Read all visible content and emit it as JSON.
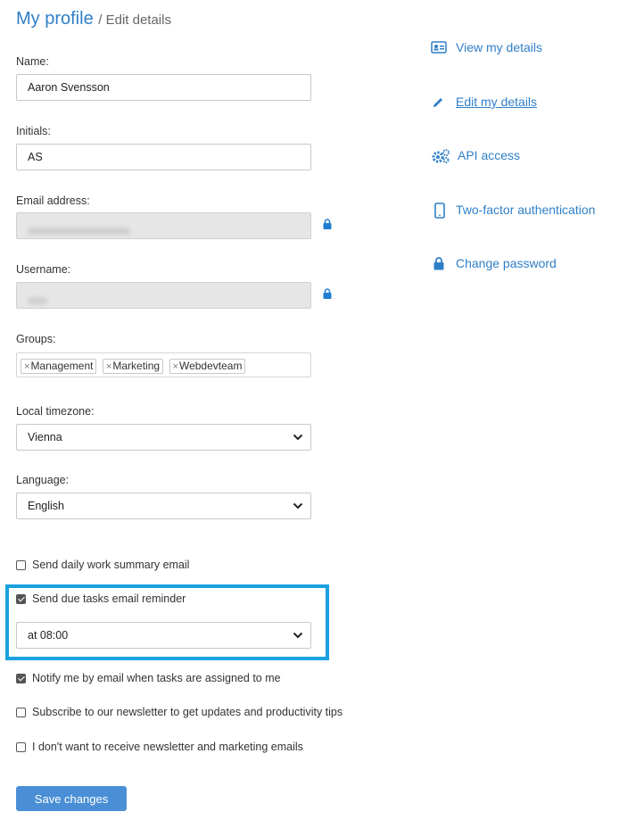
{
  "header": {
    "title": "My profile",
    "subtitle": "/ Edit details"
  },
  "form": {
    "name": {
      "label": "Name:",
      "value": "Aaron Svensson"
    },
    "initials": {
      "label": "Initials:",
      "value": "AS"
    },
    "email": {
      "label": "Email address:"
    },
    "username": {
      "label": "Username:"
    },
    "groups": {
      "label": "Groups:",
      "tags": [
        "Management",
        "Marketing",
        "Webdevteam"
      ]
    },
    "timezone": {
      "label": "Local timezone:",
      "value": "Vienna"
    },
    "language": {
      "label": "Language:",
      "value": "English"
    },
    "options": {
      "daily_summary": {
        "label": "Send daily work summary email",
        "checked": false
      },
      "due_tasks": {
        "label": "Send due tasks email reminder",
        "checked": true,
        "time": "at 08:00"
      },
      "notify_assigned": {
        "label": "Notify me by email when tasks are assigned to me",
        "checked": true
      },
      "newsletter": {
        "label": "Subscribe to our newsletter to get updates and productivity tips",
        "checked": false
      },
      "no_marketing": {
        "label": "I don't want to receive newsletter and marketing emails",
        "checked": false
      }
    },
    "save_label": "Save changes"
  },
  "sidebar": {
    "items": [
      {
        "label": "View my details",
        "icon": "id-card-icon"
      },
      {
        "label": "Edit my details",
        "icon": "pencil-icon"
      },
      {
        "label": "API access",
        "icon": "gears-icon"
      },
      {
        "label": "Two-factor authentication",
        "icon": "mobile-phone-icon"
      },
      {
        "label": "Change password",
        "icon": "lock-icon"
      }
    ]
  },
  "colors": {
    "accent": "#2f7fc8",
    "highlight": "#1aa1e0",
    "button": "#4a8fd6"
  }
}
